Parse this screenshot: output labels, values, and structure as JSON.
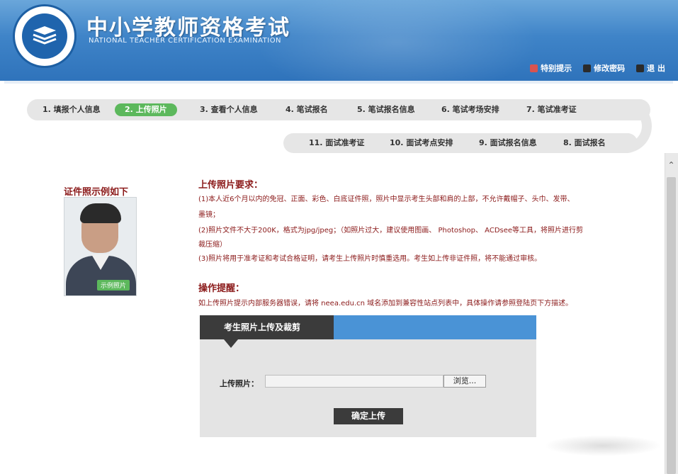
{
  "header": {
    "title_cn": "中小学教师资格考试",
    "title_en": "NATIONAL TEACHER CERTIFICATION EXAMINATION",
    "logo_text": "National Teacher Certification Examination",
    "links": [
      {
        "label": "特别提示",
        "icon": "warning-icon"
      },
      {
        "label": "修改密码",
        "icon": "key-icon"
      },
      {
        "label": "退 出",
        "icon": "logout-icon"
      }
    ]
  },
  "steps_row1": [
    "1. 填报个人信息",
    "2. 上传照片",
    "3. 查看个人信息",
    "4. 笔试报名",
    "5. 笔试报名信息",
    "6. 笔试考场安排",
    "7. 笔试准考证"
  ],
  "steps_row2": [
    "11. 面试准考证",
    "10. 面试考点安排",
    "9. 面试报名信息",
    "8. 面试报名"
  ],
  "active_step": "2. 上传照片",
  "example": {
    "title": "证件照示例如下",
    "badge": "示例照片"
  },
  "requirements": {
    "title": "上传照片要求：",
    "lines": [
      "(1)本人近6个月以内的免冠、正面、彩色、白底证件照，照片中显示考生头部和肩的上部，不允许戴帽子、头巾、发带、",
      "墨镜；",
      "(2)照片文件不大于200K，格式为jpg/jpeg；（如照片过大，建议使用图画、 Photoshop、 ACDsee等工具，将照片进行剪",
      "裁压缩）",
      "(3)照片将用于准考证和考试合格证明，请考生上传照片时慎重选用。考生如上传非证件照，将不能通过审核。"
    ]
  },
  "tip": {
    "title": "操作提醒：",
    "text": "如上传照片提示内部服务器错误，请将 neea.edu.cn 域名添加到兼容性站点列表中，具体操作请参照登陆页下方描述。"
  },
  "upload": {
    "panel_title": "考生照片上传及裁剪",
    "label": "上传照片：",
    "input_value": "",
    "browse_label": "浏览...",
    "submit_label": "确定上传"
  },
  "colors": {
    "header_blue": "#3f84c8",
    "accent_red": "#8b1a1a",
    "active_green": "#5cb85c",
    "panel_blue": "#4a93d6"
  }
}
